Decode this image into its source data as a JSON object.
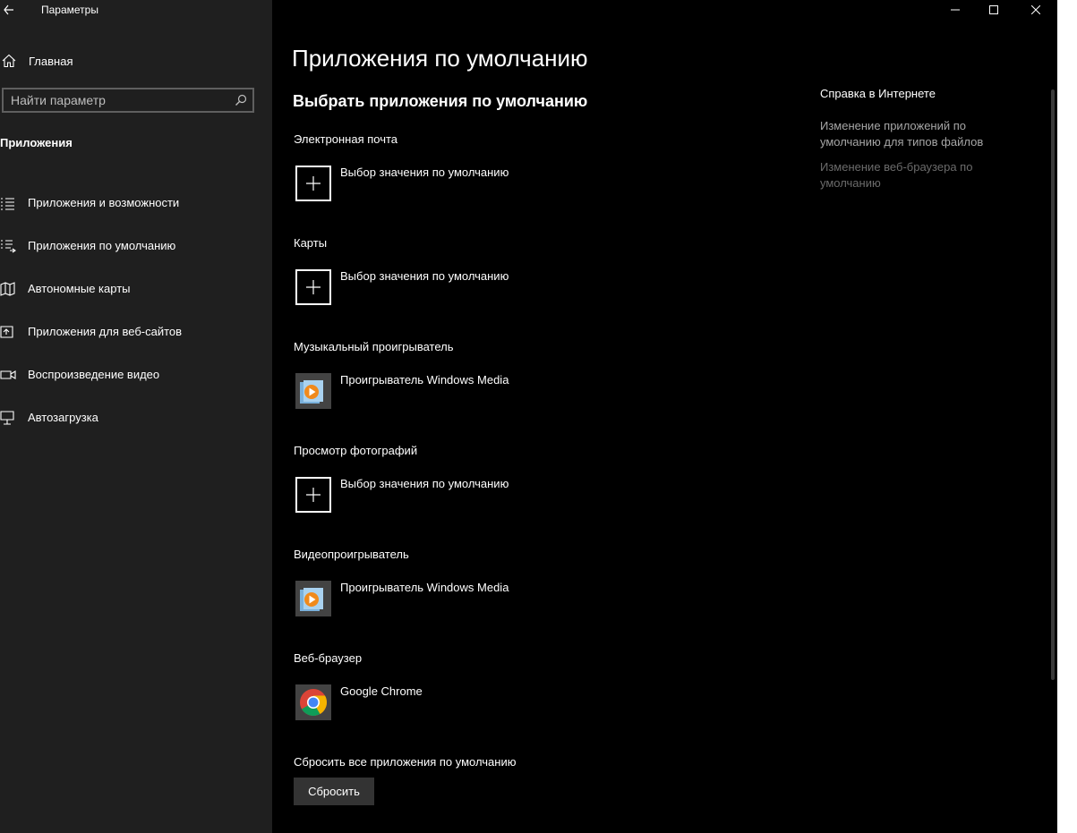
{
  "window": {
    "title": "Параметры",
    "back_icon": "arrow-left-icon",
    "controls": [
      "minimize",
      "maximize",
      "close"
    ]
  },
  "sidebar": {
    "home_label": "Главная",
    "search_placeholder": "Найти параметр",
    "section_title": "Приложения",
    "items": [
      {
        "label": "Приложения и возможности",
        "icon": "apps-list-icon"
      },
      {
        "label": "Приложения по умолчанию",
        "icon": "default-apps-icon"
      },
      {
        "label": "Автономные карты",
        "icon": "offline-maps-icon"
      },
      {
        "label": "Приложения для веб-сайтов",
        "icon": "apps-websites-icon"
      },
      {
        "label": "Воспроизведение видео",
        "icon": "video-playback-icon"
      },
      {
        "label": "Автозагрузка",
        "icon": "startup-icon"
      }
    ]
  },
  "main": {
    "title": "Приложения по умолчанию",
    "subtitle": "Выбрать приложения по умолчанию",
    "categories": [
      {
        "label": "Электронная почта",
        "choice": "Выбор значения по умолчанию",
        "icon": "plus-icon"
      },
      {
        "label": "Карты",
        "choice": "Выбор значения по умолчанию",
        "icon": "plus-icon"
      },
      {
        "label": "Музыкальный проигрыватель",
        "choice": "Проигрыватель Windows Media",
        "icon": "windows-media-player-icon"
      },
      {
        "label": "Просмотр фотографий",
        "choice": "Выбор значения по умолчанию",
        "icon": "plus-icon"
      },
      {
        "label": "Видеопроигрыватель",
        "choice": "Проигрыватель Windows Media",
        "icon": "windows-media-player-icon"
      },
      {
        "label": "Веб-браузер",
        "choice": "Google Chrome",
        "icon": "chrome-icon"
      }
    ],
    "reset_label": "Сбросить все приложения по умолчанию",
    "reset_button": "Сбросить"
  },
  "help": {
    "title": "Справка в Интернете",
    "links": [
      "Изменение приложений по умолчанию для типов файлов",
      "Изменение веб-браузера по умолчанию"
    ]
  },
  "colors": {
    "sidebar_bg": "#1f1f1f",
    "content_bg": "#000000",
    "button_bg": "#333333",
    "link_color": "#a6a6a6",
    "link_disabled": "#6b6b6b"
  }
}
